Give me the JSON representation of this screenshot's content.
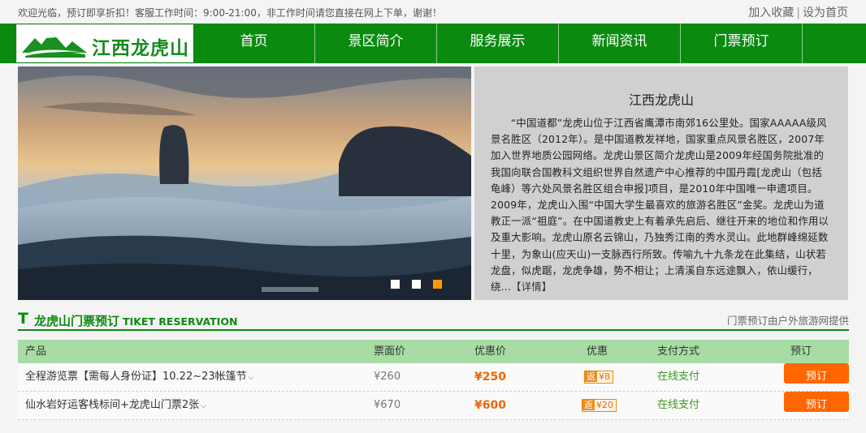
{
  "topbar": {
    "notice": "欢迎光临，预订即享折扣！客服工作时间：9:00-21:00，非工作时间请您直接在网上下单，谢谢！",
    "favorite_label": "加入收藏",
    "separator": "|",
    "homepage_label": "设为首页"
  },
  "logo": {
    "text": "江西龙虎山"
  },
  "nav": {
    "items": [
      "首页",
      "景区简介",
      "服务展示",
      "新闻资讯",
      "门票预订"
    ]
  },
  "intro": {
    "title": "江西龙虎山",
    "body": "“中国道都”龙虎山位于江西省鹰潭市南郊16公里处。国家AAAAA级风景名胜区（2012年）。是中国道教发祥地，国家重点风景名胜区，2007年加入世界地质公园网络。龙虎山景区简介龙虎山是2009年经国务院批准的我国向联合国教科文组织世界自然遗产中心推荐的中国丹霞[龙虎山（包括龟峰）等六处风景名胜区组合申报]项目，是2010年中国唯一申遗项目。2009年，龙虎山入围“中国大学生最喜欢的旅游名胜区”金奖。龙虎山为道教正一派“祖庭”。在中国道教史上有着承先启后、继往开来的地位和作用以及重大影响。龙虎山原名云锦山，乃独秀江南的秀水灵山。此地群峰绵延数十里，为象山(应天山)一支脉西行所致。传喻九十九条龙在此集结，山状若龙盘，似虎踞，龙虎争雄，势不相让；上清溪自东远途飘入，依山缓行，绕...",
    "more_label": "【详情】"
  },
  "section": {
    "icon": "T",
    "title": "龙虎山门票预订",
    "title_en": "TIKET RESERVATION",
    "provider": "门票预订由户外旅游网提供"
  },
  "table": {
    "headers": {
      "product": "产品",
      "face_price": "票面价",
      "promo_price": "优惠价",
      "discount": "优惠",
      "payment": "支付方式",
      "book": "预订"
    },
    "rows": [
      {
        "product": "全程游览票【需每人身份证】10.22~23帐篷节",
        "face_price": "¥260",
        "promo_price": "¥250",
        "discount_tag": "返",
        "discount_amount": "¥8",
        "payment": "在线支付",
        "book_label": "预订"
      },
      {
        "product": "仙水岩好运客栈标间+龙虎山门票2张",
        "face_price": "¥670",
        "promo_price": "¥600",
        "discount_tag": "返",
        "discount_amount": "¥20",
        "payment": "在线支付",
        "book_label": "预订"
      }
    ]
  },
  "colors": {
    "brand_green": "#0b8a10",
    "table_header": "#a7dda5",
    "accent_orange": "#ff6600"
  }
}
